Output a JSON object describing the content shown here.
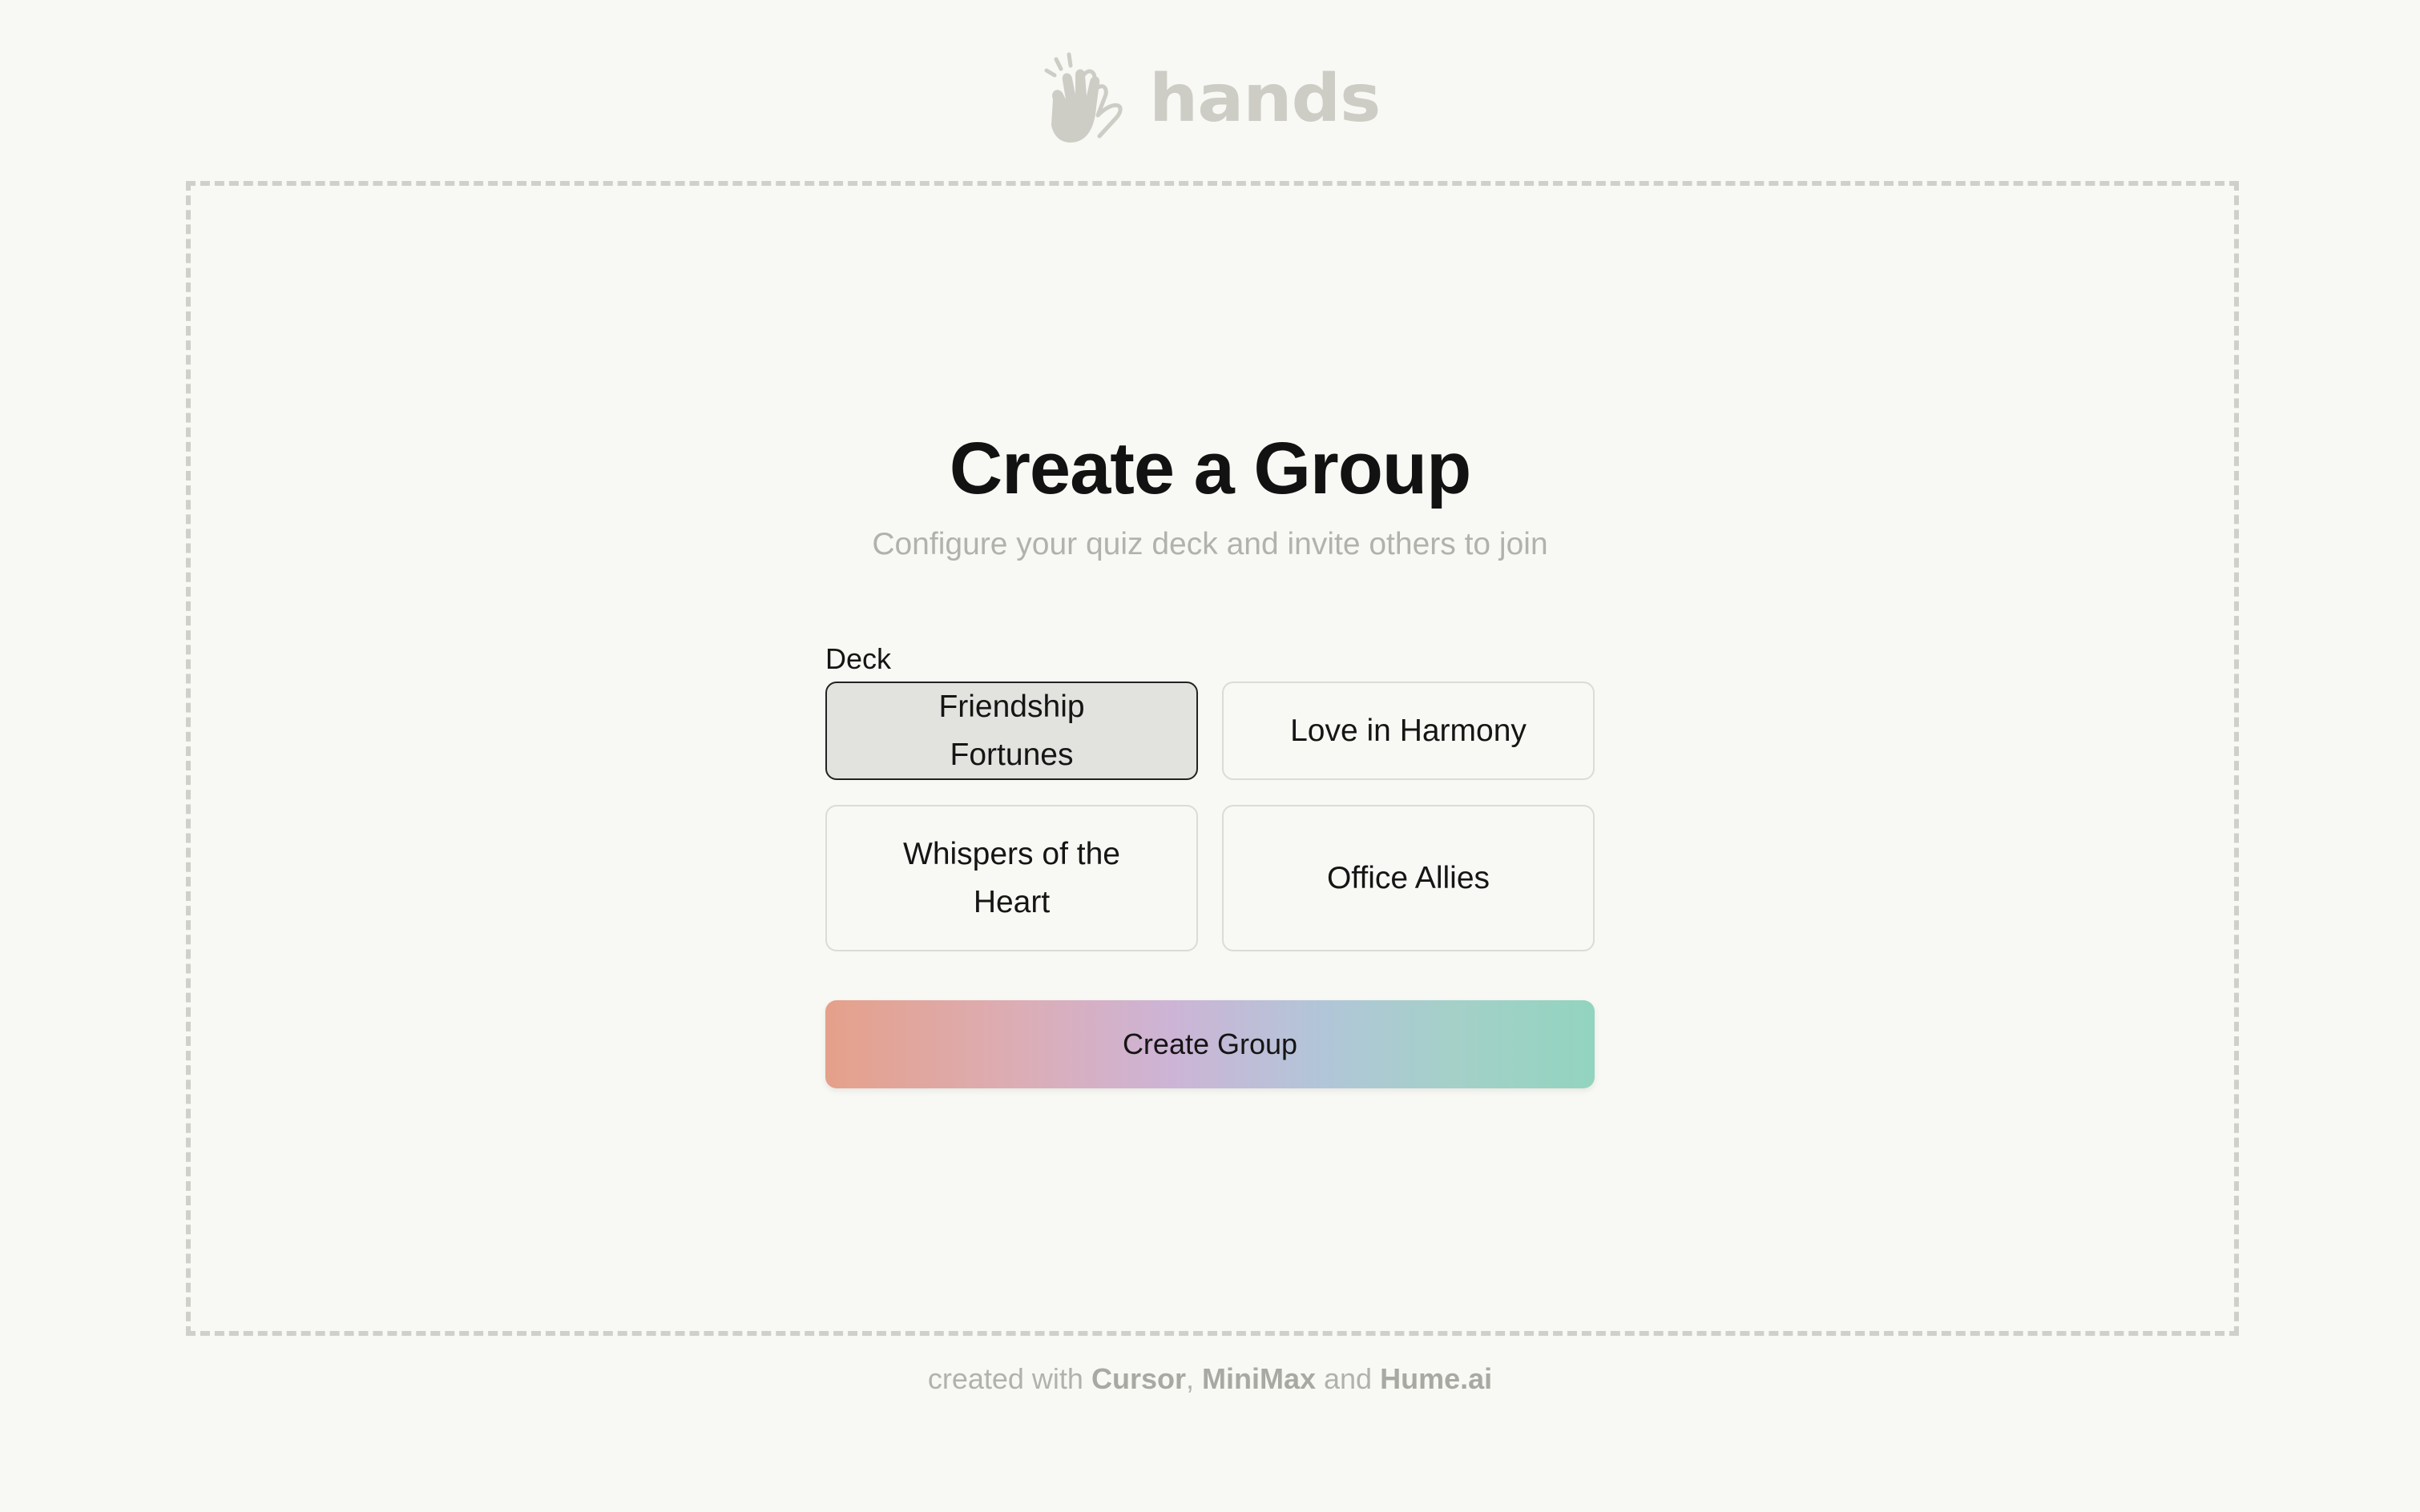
{
  "logo": {
    "icon": "clapping-hand-icon",
    "text": "hands",
    "color": "#cdcdc6"
  },
  "header": {
    "title": "Create a Group",
    "subtitle": "Configure your quiz deck and invite others to join"
  },
  "deck": {
    "label": "Deck",
    "selected": "Friendship Fortunes",
    "options": [
      {
        "label": "Friendship Fortunes",
        "selected": true
      },
      {
        "label": "Love in Harmony",
        "selected": false
      },
      {
        "label": "Whispers of the Heart",
        "selected": false
      },
      {
        "label": "Office Allies",
        "selected": false
      }
    ]
  },
  "actions": {
    "create_label": "Create Group",
    "gradient_colors": [
      "#e5a08a",
      "#cdb4d6",
      "#92d4bf"
    ]
  },
  "footer": {
    "prefix": "created with ",
    "tool_1": "Cursor",
    "sep_1": ", ",
    "tool_2": "MiniMax",
    "sep_2": " and ",
    "tool_3": "Hume.ai"
  }
}
